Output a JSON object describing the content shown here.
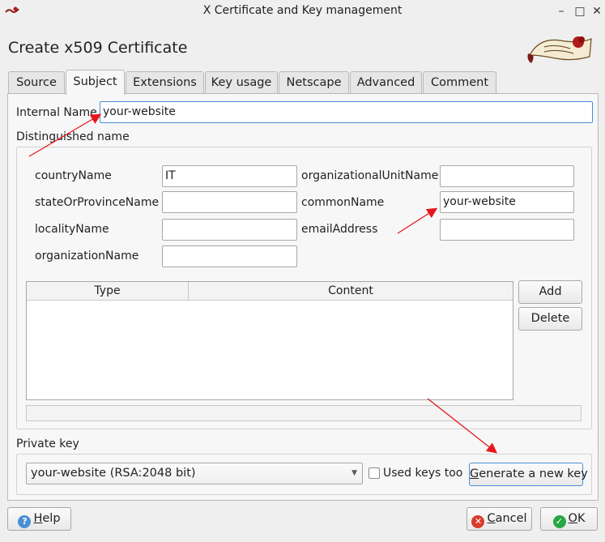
{
  "window": {
    "title": "X Certificate and Key management"
  },
  "dialog": {
    "title": "Create x509 Certificate"
  },
  "tabs": [
    {
      "label": "Source"
    },
    {
      "label": "Subject"
    },
    {
      "label": "Extensions"
    },
    {
      "label": "Key usage"
    },
    {
      "label": "Netscape"
    },
    {
      "label": "Advanced"
    },
    {
      "label": "Comment"
    }
  ],
  "active_tab": "Subject",
  "subject": {
    "internal_name_label": "Internal Name",
    "internal_name_value": "your-website",
    "distinguished_name_label": "Distinguished name",
    "fields": {
      "countryName": {
        "label": "countryName",
        "value": "IT"
      },
      "stateOrProvinceName": {
        "label": "stateOrProvinceName",
        "value": ""
      },
      "localityName": {
        "label": "localityName",
        "value": ""
      },
      "organizationName": {
        "label": "organizationName",
        "value": ""
      },
      "organizationalUnitName": {
        "label": "organizationalUnitName",
        "value": ""
      },
      "commonName": {
        "label": "commonName",
        "value": "your-website"
      },
      "emailAddress": {
        "label": "emailAddress",
        "value": ""
      }
    },
    "table": {
      "headers": [
        "Type",
        "Content"
      ],
      "rows": []
    },
    "add_button": "Add",
    "delete_button": "Delete",
    "private_key_label": "Private key",
    "private_key_selected": "your-website (RSA:2048 bit)",
    "used_keys_too_label": "Used keys too",
    "used_keys_too_checked": false,
    "generate_key_button": "Generate a new key"
  },
  "footer": {
    "help": "Help",
    "cancel": "Cancel",
    "ok": "OK"
  },
  "icons": {
    "help": "help-icon",
    "cancel": "cancel-icon",
    "ok": "ok-icon"
  },
  "colors": {
    "annotation_arrow": "#e8161b",
    "focus_border": "#4a8fd6",
    "cancel_icon": "#d93a2b",
    "ok_icon": "#28a745",
    "help_icon": "#4a8fd6"
  }
}
